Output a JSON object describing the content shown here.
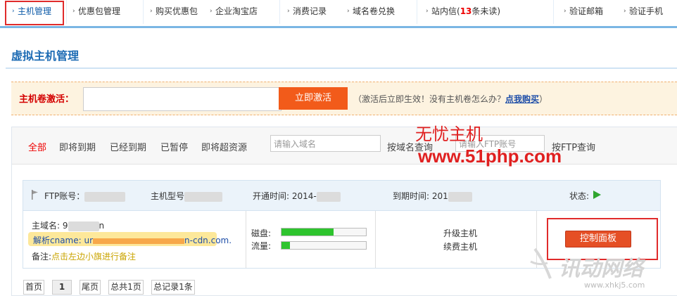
{
  "nav": {
    "tabs": [
      {
        "label": "主机管理"
      },
      {
        "label": "优惠包管理"
      },
      {
        "label": "购买优惠包"
      },
      {
        "label": "企业淘宝店"
      },
      {
        "label": "消费记录"
      },
      {
        "label": "域名卷兑换"
      },
      {
        "label": "站内信(",
        "count": "13",
        "suffix": "条未读)"
      },
      {
        "label": "验证邮箱"
      },
      {
        "label": "验证手机"
      }
    ]
  },
  "page_title": "虚拟主机管理",
  "activation": {
    "label": "主机卷激活：",
    "input_value": "",
    "button": "立即激活",
    "note_prefix": "（激活后立即生效！没有主机卷怎么办？",
    "note_link": "点我购买",
    "note_suffix": "）"
  },
  "filters": {
    "items": [
      "全部",
      "即将到期",
      "已经到期",
      "已暂停",
      "即将超资源"
    ],
    "domain_placeholder": "请输入域名",
    "domain_button": "按域名查询",
    "ftp_placeholder": "请输入FTP账号",
    "ftp_button": "按FTP查询"
  },
  "watermark": {
    "line1": "无忧主机",
    "line2": "www.51php.com"
  },
  "host": {
    "ftp_label": "FTP账号：",
    "type_label": "主机型号",
    "open_label": "开通时间: 2014-",
    "expire_label": "到期时间: 201",
    "status_label": "状态:",
    "domain_label": "主域名: 9",
    "domain_tail": "n",
    "cname_label": "解析cname: ur",
    "cname_tail": "n-cdn.com.",
    "remark_label": "备注:",
    "remark_text": "点击左边小旗进行备注",
    "disk_label": "磁盘:",
    "disk_usage": 0.62,
    "traffic_label": "流量:",
    "traffic_usage": 0.1,
    "upgrade": "升级主机",
    "renew": "续费主机",
    "control_button": "控制面板",
    "status_color": "#2fa52f"
  },
  "pager": {
    "first": "首页",
    "current": "1",
    "last": "尾页",
    "total_pages": "总共1页",
    "total_records": "总记录1条"
  },
  "logo": {
    "text": "讯动网络",
    "url_text": "www.xhkj5.com"
  }
}
